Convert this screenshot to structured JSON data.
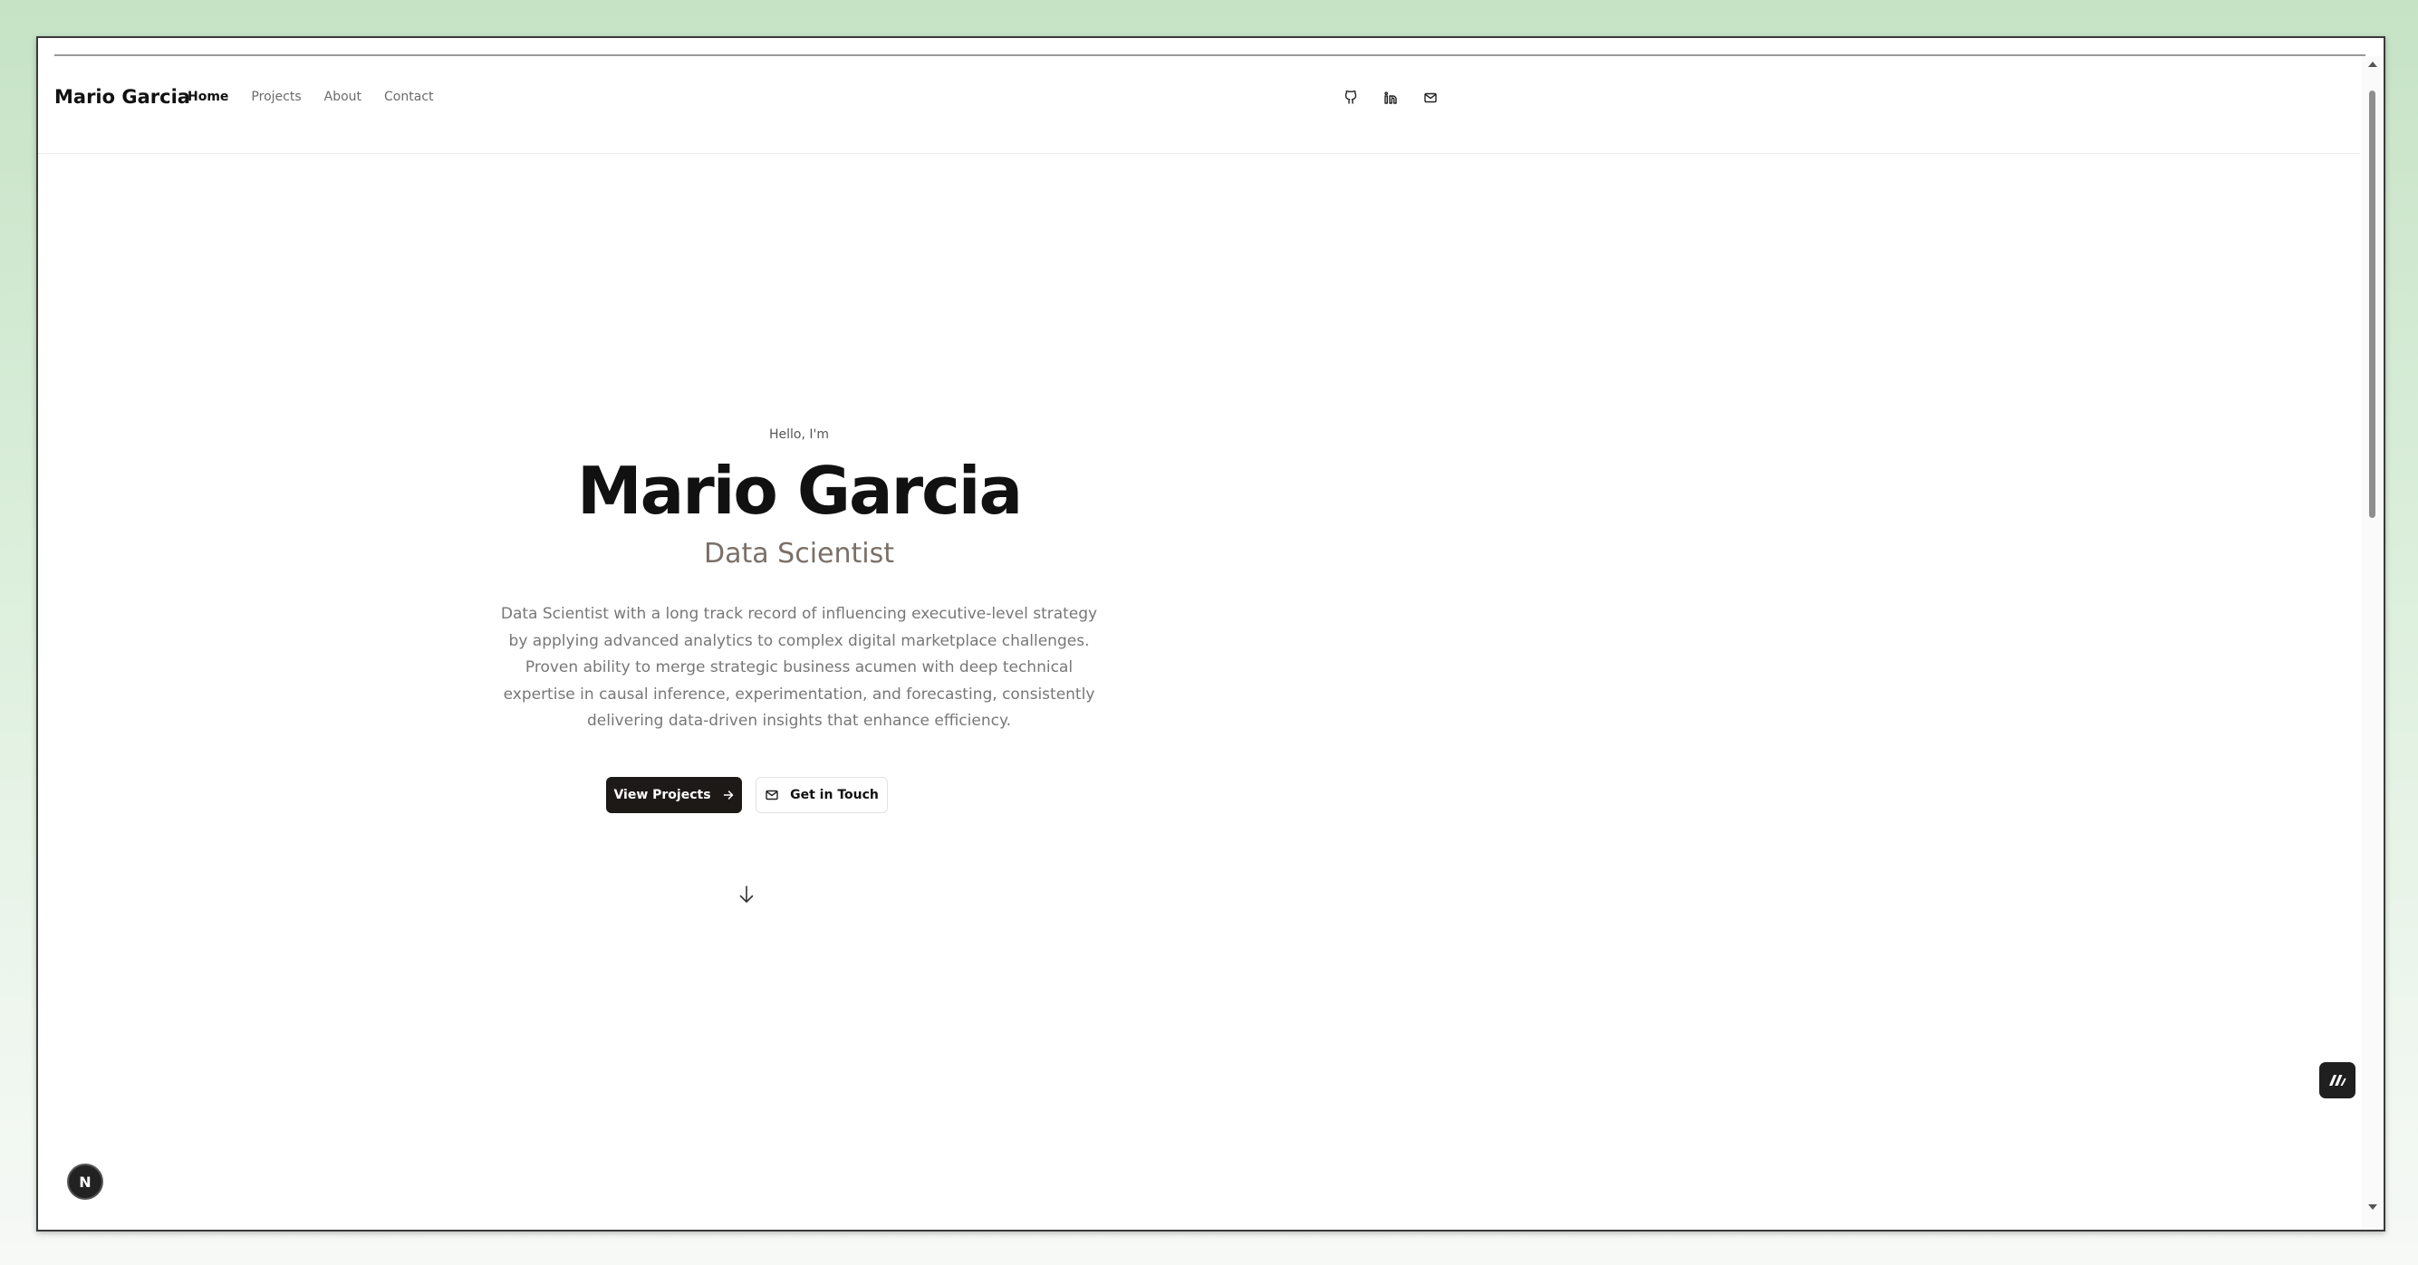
{
  "header": {
    "brand": "Mario Garcia",
    "nav": [
      {
        "label": "Home",
        "active": true
      },
      {
        "label": "Projects",
        "active": false
      },
      {
        "label": "About",
        "active": false
      },
      {
        "label": "Contact",
        "active": false
      }
    ],
    "social_icons": [
      "github-icon",
      "linkedin-icon",
      "mail-icon"
    ]
  },
  "hero": {
    "greeting": "Hello, I'm",
    "name": "Mario Garcia",
    "role": "Data Scientist",
    "description": "Data Scientist with a long track record of influencing executive-level strategy by applying advanced analytics to complex digital marketplace challenges. Proven ability to merge strategic business acumen with deep technical expertise in causal inference, experimentation, and forecasting, consistently delivering data-driven insights that enhance efficiency.",
    "primary_button": "View Projects",
    "secondary_button": "Get in Touch"
  },
  "colors": {
    "primary_button_bg": "#1c1917",
    "role_text": "#7a7068",
    "background_gradient_top": "#c6e3c6"
  },
  "badges": {
    "bottom_left_letter": "N"
  }
}
